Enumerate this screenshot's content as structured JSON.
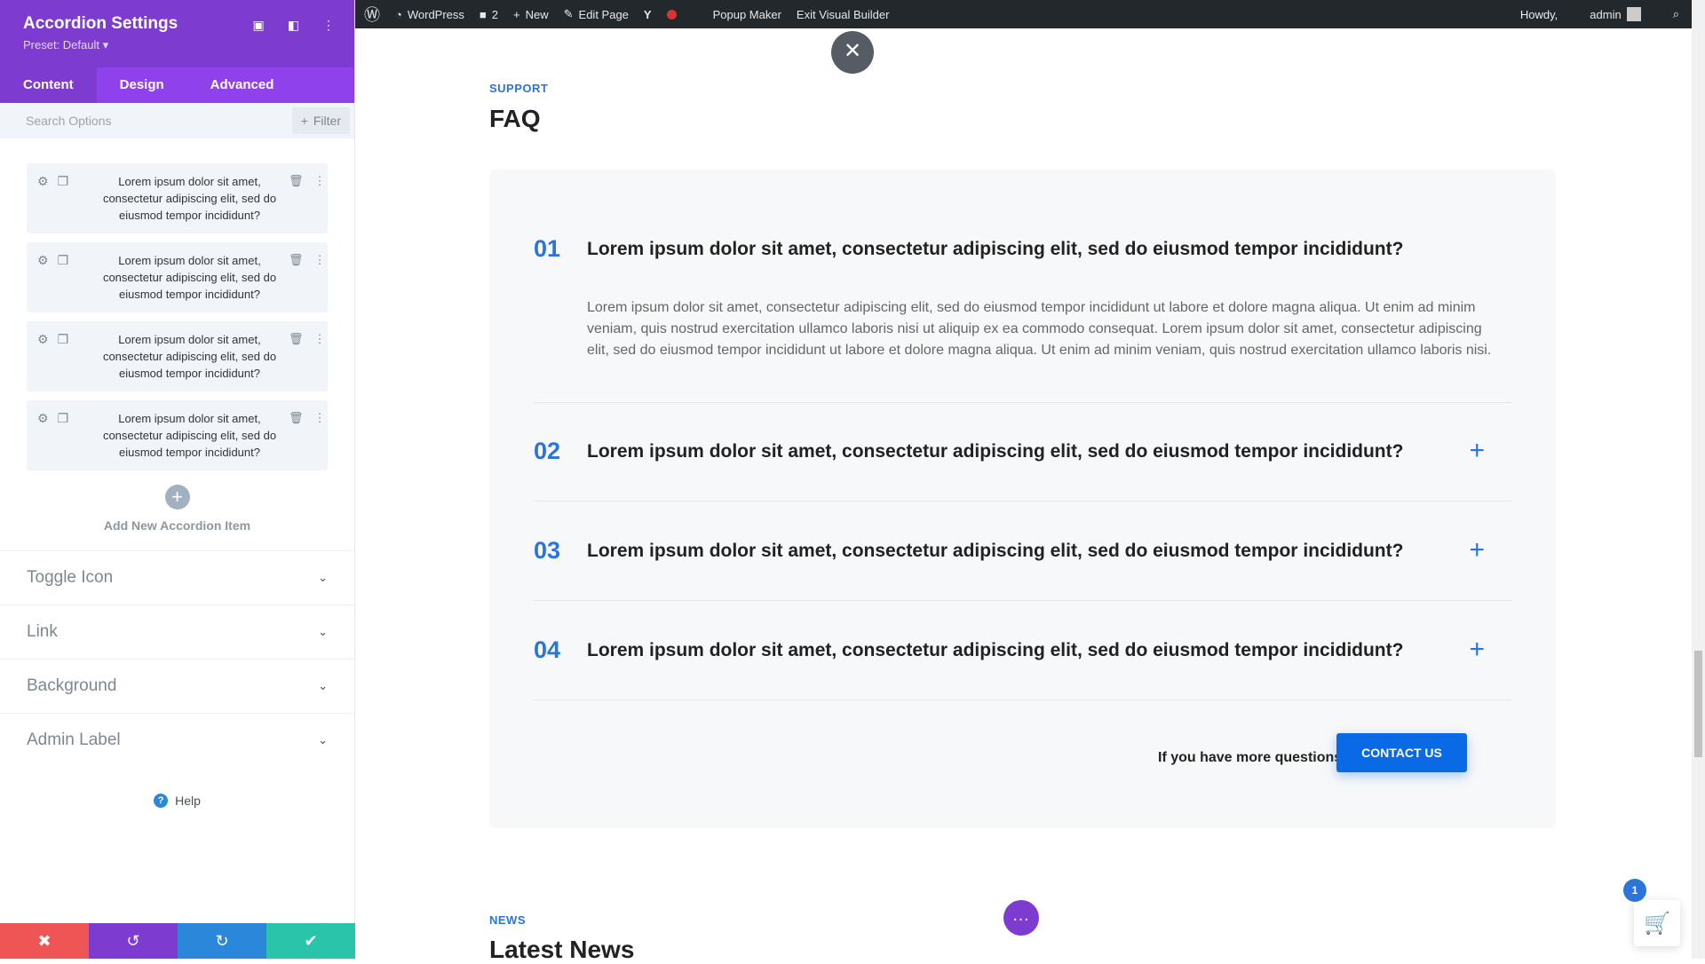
{
  "sidebar": {
    "title": "Accordion Settings",
    "preset": "Preset: Default ▾",
    "tabs": [
      {
        "label": "Content"
      },
      {
        "label": "Design"
      },
      {
        "label": "Advanced"
      }
    ],
    "search_placeholder": "Search Options",
    "filter_label": "Filter",
    "items": [
      {
        "text": "Lorem ipsum dolor sit amet, consectetur adipiscing elit, sed do eiusmod tempor incididunt?"
      },
      {
        "text": "Lorem ipsum dolor sit amet, consectetur adipiscing elit, sed do eiusmod tempor incididunt?"
      },
      {
        "text": "Lorem ipsum dolor sit amet, consectetur adipiscing elit, sed do eiusmod tempor incididunt?"
      },
      {
        "text": "Lorem ipsum dolor sit amet, consectetur adipiscing elit, sed do eiusmod tempor incididunt?"
      }
    ],
    "add_new_label": "Add New Accordion Item",
    "sections": [
      {
        "label": "Toggle Icon"
      },
      {
        "label": "Link"
      },
      {
        "label": "Background"
      },
      {
        "label": "Admin Label"
      }
    ],
    "help_label": "Help",
    "bottom_colors": {
      "cancel": "#ef5555",
      "undo": "#7e3bd0",
      "redo": "#2b87da",
      "save": "#29c4a9"
    }
  },
  "adminbar": {
    "site": "WordPress",
    "comments": "2",
    "new": "New",
    "edit_page": "Edit Page",
    "popup_maker": "Popup Maker",
    "exit_builder": "Exit Visual Builder",
    "howdy": "Howdy,",
    "user": "admin"
  },
  "main": {
    "faq_eyebrow": "SUPPORT",
    "faq_title": "FAQ",
    "faqs": [
      {
        "num": "01",
        "question": "Lorem ipsum dolor sit amet, consectetur adipiscing elit, sed do eiusmod tempor incididunt?",
        "answer": "Lorem ipsum dolor sit amet, consectetur adipiscing elit, sed do eiusmod tempor incididunt ut labore et dolore magna aliqua. Ut enim ad minim veniam, quis nostrud exercitation ullamco laboris nisi ut aliquip ex ea commodo consequat. Lorem ipsum dolor sit amet, consectetur adipiscing elit, sed do eiusmod tempor incididunt ut labore et dolore magna aliqua. Ut enim ad minim veniam, quis nostrud exercitation ullamco laboris nisi."
      },
      {
        "num": "02",
        "question": "Lorem ipsum dolor sit amet, consectetur adipiscing elit, sed do eiusmod tempor incididunt?"
      },
      {
        "num": "03",
        "question": "Lorem ipsum dolor sit amet, consectetur adipiscing elit, sed do eiusmod tempor incididunt?"
      },
      {
        "num": "04",
        "question": "Lorem ipsum dolor sit amet, consectetur adipiscing elit, sed do eiusmod tempor incididunt?"
      }
    ],
    "cta_text": "If you have more questions",
    "cta_button": "CONTACT US",
    "news_eyebrow": "NEWS",
    "news_title": "Latest News",
    "cart_count": "1"
  }
}
